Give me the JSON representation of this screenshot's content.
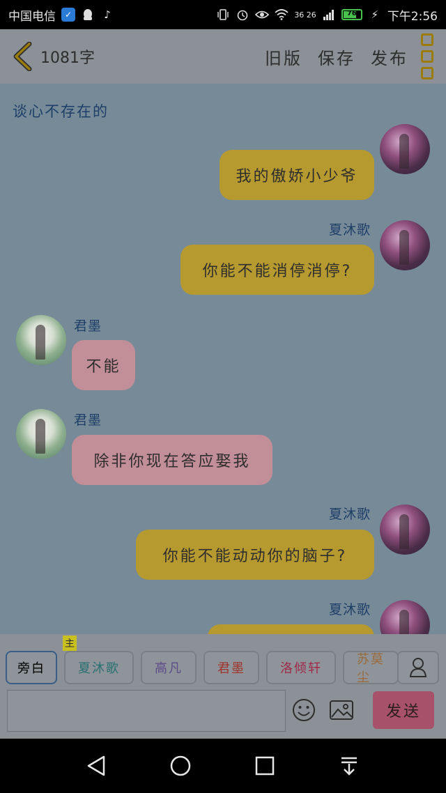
{
  "status_bar": {
    "carrier": "中国电信",
    "network": "36 26",
    "battery": "76",
    "battery_level": 0.76,
    "time": "下午2:56"
  },
  "header": {
    "word_count": "1081字",
    "actions": [
      "旧版",
      "保存",
      "发布"
    ]
  },
  "chat": {
    "title": "谈心不存在的",
    "messages": [
      {
        "sender": "",
        "side": "right",
        "text": "我的傲娇小少爷"
      },
      {
        "sender": "夏沐歌",
        "side": "right",
        "text": "你能不能消停消停?"
      },
      {
        "sender": "君墨",
        "side": "left",
        "text": "不能"
      },
      {
        "sender": "君墨",
        "side": "left",
        "text": "除非你现在答应娶我"
      },
      {
        "sender": "夏沐歌",
        "side": "right",
        "text": "你能不能动动你的脑子?"
      },
      {
        "sender": "夏沐歌",
        "side": "right",
        "text": ""
      }
    ]
  },
  "composer": {
    "roles": [
      {
        "label": "旁白",
        "color": "#2d2d2d",
        "tag": ""
      },
      {
        "label": "夏沐歌",
        "color": "#2a6f73",
        "tag": "主"
      },
      {
        "label": "高凡",
        "color": "#5d4a8a",
        "tag": ""
      },
      {
        "label": "君墨",
        "color": "#a0342d",
        "tag": ""
      },
      {
        "label": "洛倾轩",
        "color": "#a02a4a",
        "tag": ""
      },
      {
        "label": "苏莫尘",
        "color": "#9a6a3a",
        "tag": ""
      }
    ],
    "input_value": "",
    "send_label": "发送"
  },
  "colors": {
    "my_bubble": "#b79a2f",
    "other_bubble": "#c28e97",
    "send_button": "#a8516b"
  }
}
